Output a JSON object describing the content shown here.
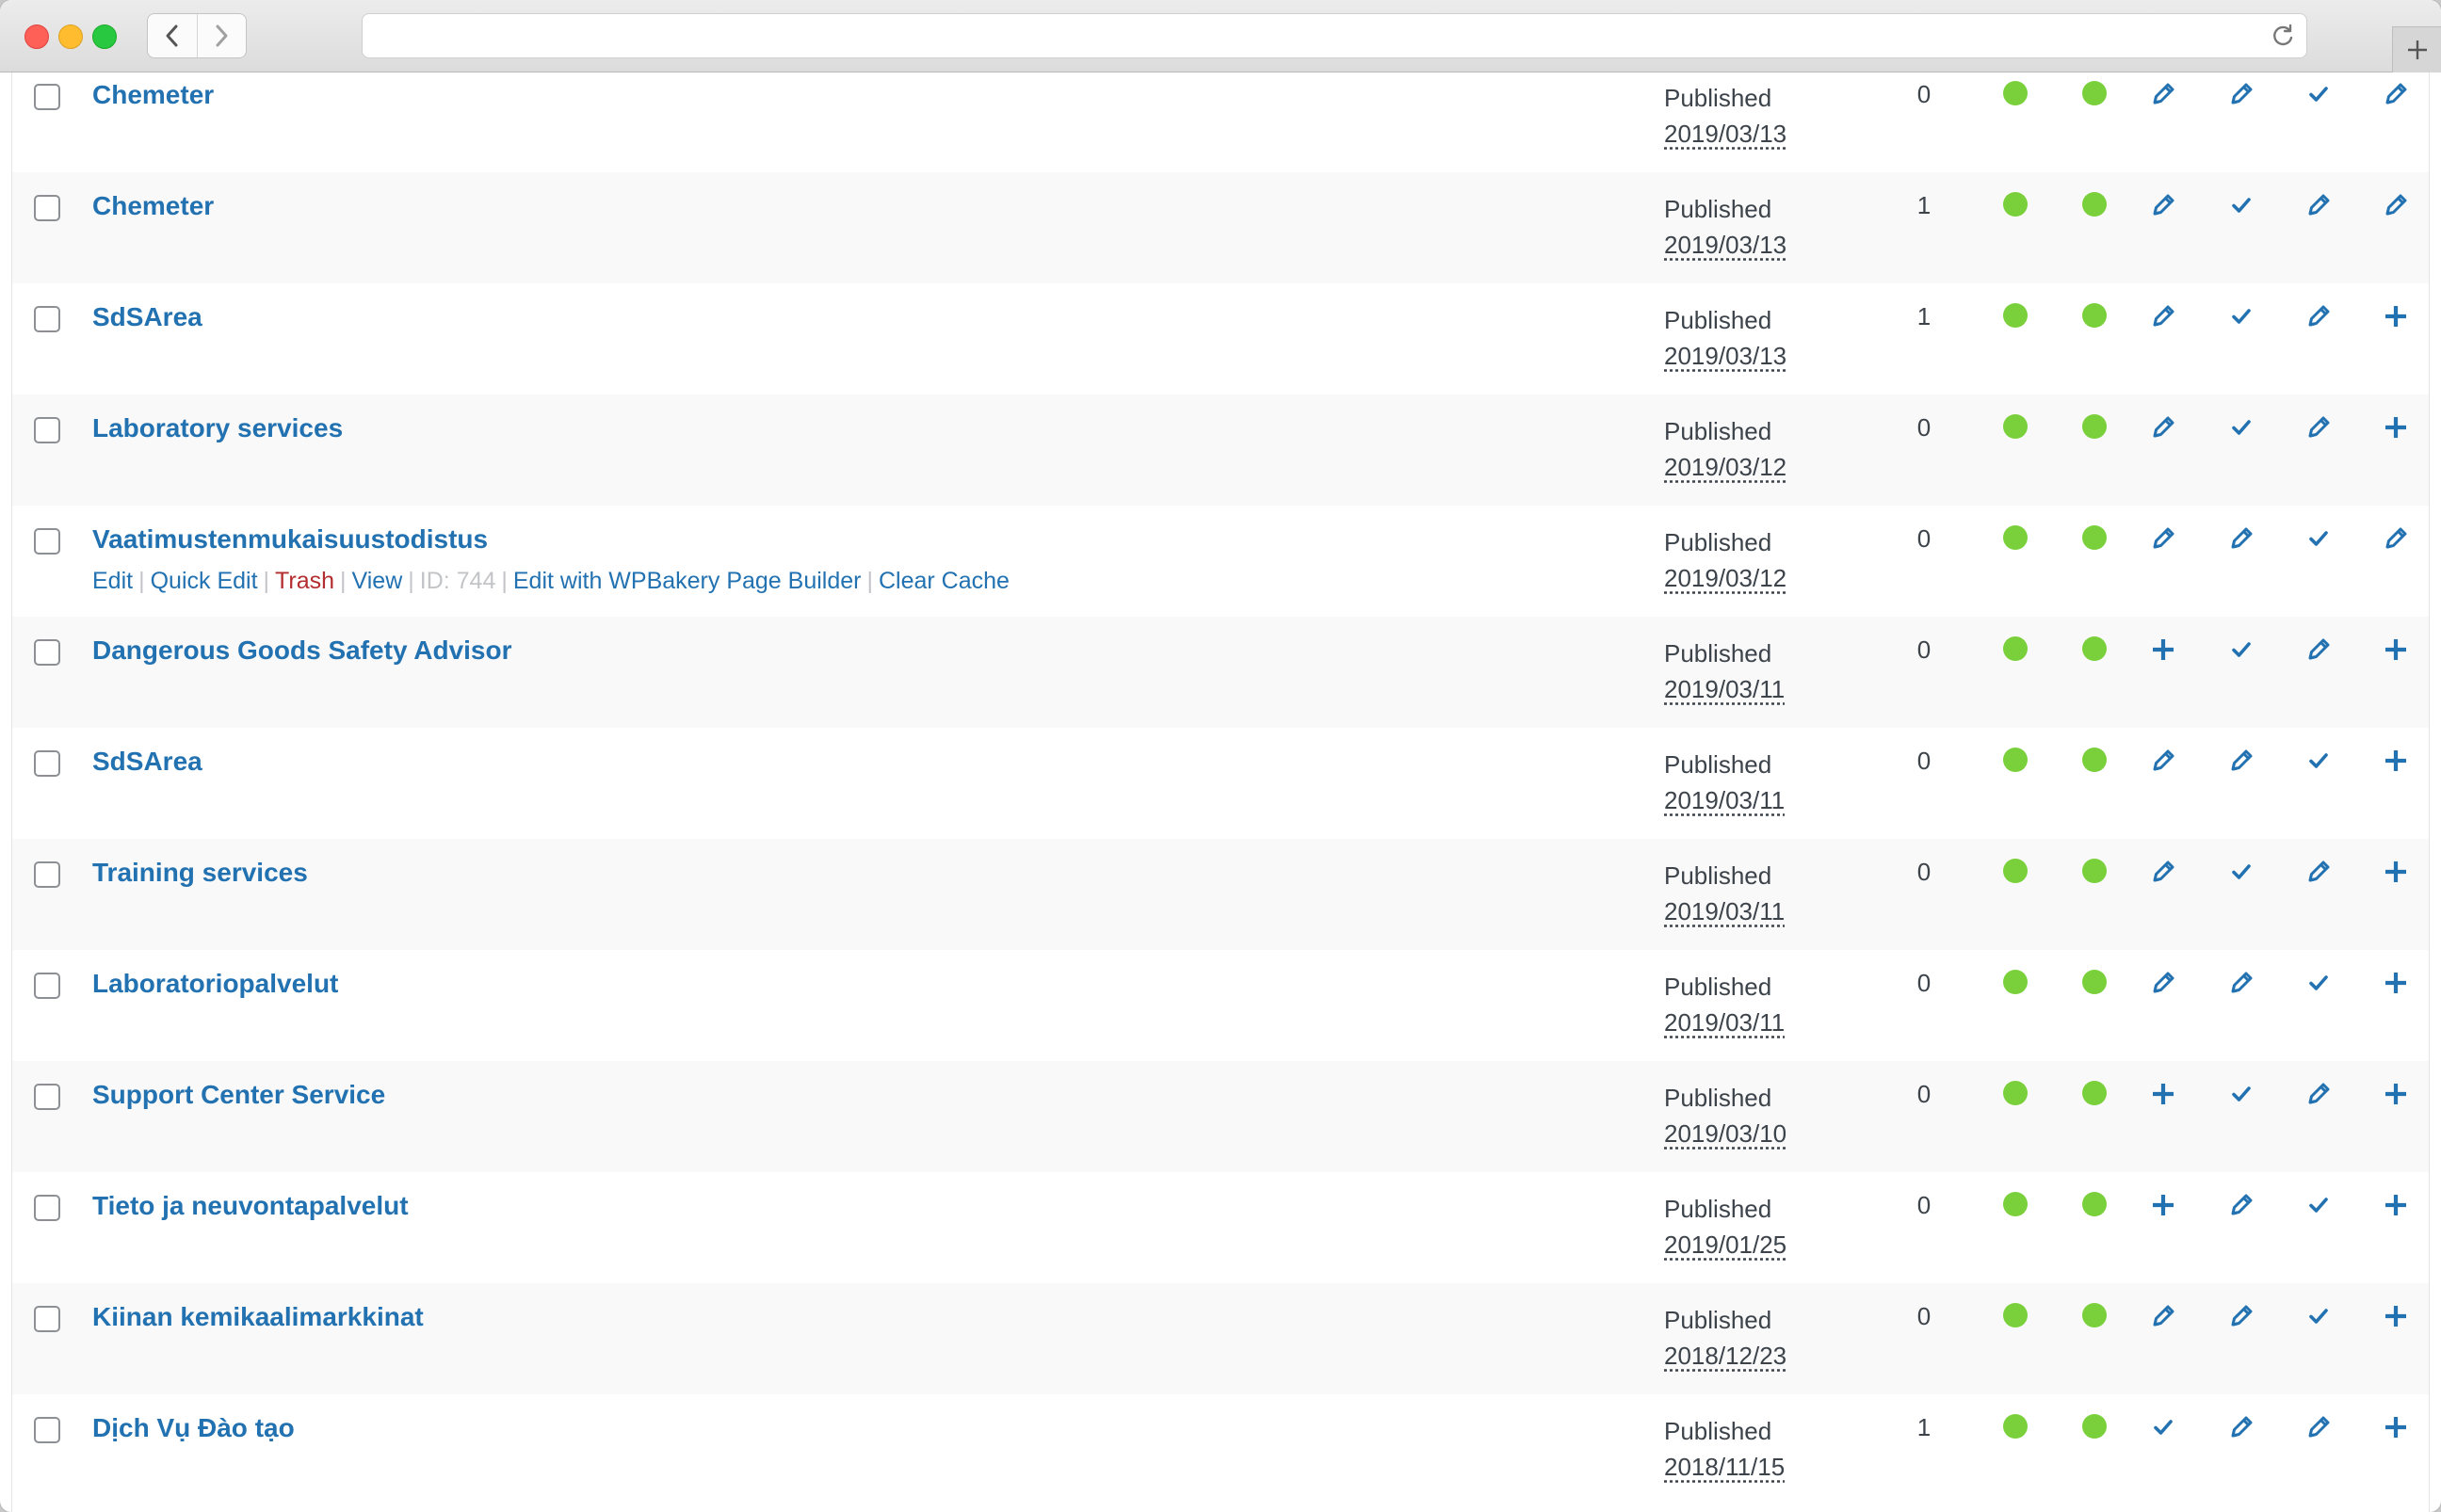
{
  "browser": {
    "url": ""
  },
  "actions_labels": {
    "edit": "Edit",
    "quick_edit": "Quick Edit",
    "trash": "Trash",
    "view": "View",
    "id": "ID: 744",
    "wpbakery": "Edit with WPBakery Page Builder",
    "clear_cache": "Clear Cache"
  },
  "colors": {
    "link": "#2271b1",
    "dot_green": "#7ad03a",
    "trash_red": "#b32d2e"
  },
  "rows": [
    {
      "title": "Chemeter",
      "status": "Published",
      "date": "2019/03/13",
      "count": "0",
      "icons": [
        "pencil-icon",
        "pencil-icon",
        "check-icon",
        "pencil-icon"
      ]
    },
    {
      "title": "Chemeter",
      "status": "Published",
      "date": "2019/03/13",
      "count": "1",
      "icons": [
        "pencil-icon",
        "check-icon",
        "pencil-icon",
        "pencil-icon"
      ]
    },
    {
      "title": "SdSArea",
      "status": "Published",
      "date": "2019/03/13",
      "count": "1",
      "icons": [
        "pencil-icon",
        "check-icon",
        "pencil-icon",
        "plus-icon"
      ]
    },
    {
      "title": "Laboratory services",
      "status": "Published",
      "date": "2019/03/12",
      "count": "0",
      "icons": [
        "pencil-icon",
        "check-icon",
        "pencil-icon",
        "plus-icon"
      ]
    },
    {
      "title": "Vaatimustenmukaisuustodistus",
      "status": "Published",
      "date": "2019/03/12",
      "count": "0",
      "icons": [
        "pencil-icon",
        "pencil-icon",
        "check-icon",
        "pencil-icon"
      ],
      "show_actions": true
    },
    {
      "title": "Dangerous Goods Safety Advisor",
      "status": "Published",
      "date": "2019/03/11",
      "count": "0",
      "icons": [
        "plus-icon",
        "check-icon",
        "pencil-icon",
        "plus-icon"
      ]
    },
    {
      "title": "SdSArea",
      "status": "Published",
      "date": "2019/03/11",
      "count": "0",
      "icons": [
        "pencil-icon",
        "pencil-icon",
        "check-icon",
        "plus-icon"
      ]
    },
    {
      "title": "Training services",
      "status": "Published",
      "date": "2019/03/11",
      "count": "0",
      "icons": [
        "pencil-icon",
        "check-icon",
        "pencil-icon",
        "plus-icon"
      ]
    },
    {
      "title": "Laboratoriopalvelut",
      "status": "Published",
      "date": "2019/03/11",
      "count": "0",
      "icons": [
        "pencil-icon",
        "pencil-icon",
        "check-icon",
        "plus-icon"
      ]
    },
    {
      "title": "Support Center Service",
      "status": "Published",
      "date": "2019/03/10",
      "count": "0",
      "icons": [
        "plus-icon",
        "check-icon",
        "pencil-icon",
        "plus-icon"
      ]
    },
    {
      "title": "Tieto ja neuvontapalvelut",
      "status": "Published",
      "date": "2019/01/25",
      "count": "0",
      "icons": [
        "plus-icon",
        "pencil-icon",
        "check-icon",
        "plus-icon"
      ]
    },
    {
      "title": "Kiinan kemikaalimarkkinat",
      "status": "Published",
      "date": "2018/12/23",
      "count": "0",
      "icons": [
        "pencil-icon",
        "pencil-icon",
        "check-icon",
        "plus-icon"
      ]
    },
    {
      "title": "Dịch Vụ Đào tạo",
      "status": "Published",
      "date": "2018/11/15",
      "count": "1",
      "icons": [
        "check-icon",
        "pencil-icon",
        "pencil-icon",
        "plus-icon"
      ]
    }
  ]
}
